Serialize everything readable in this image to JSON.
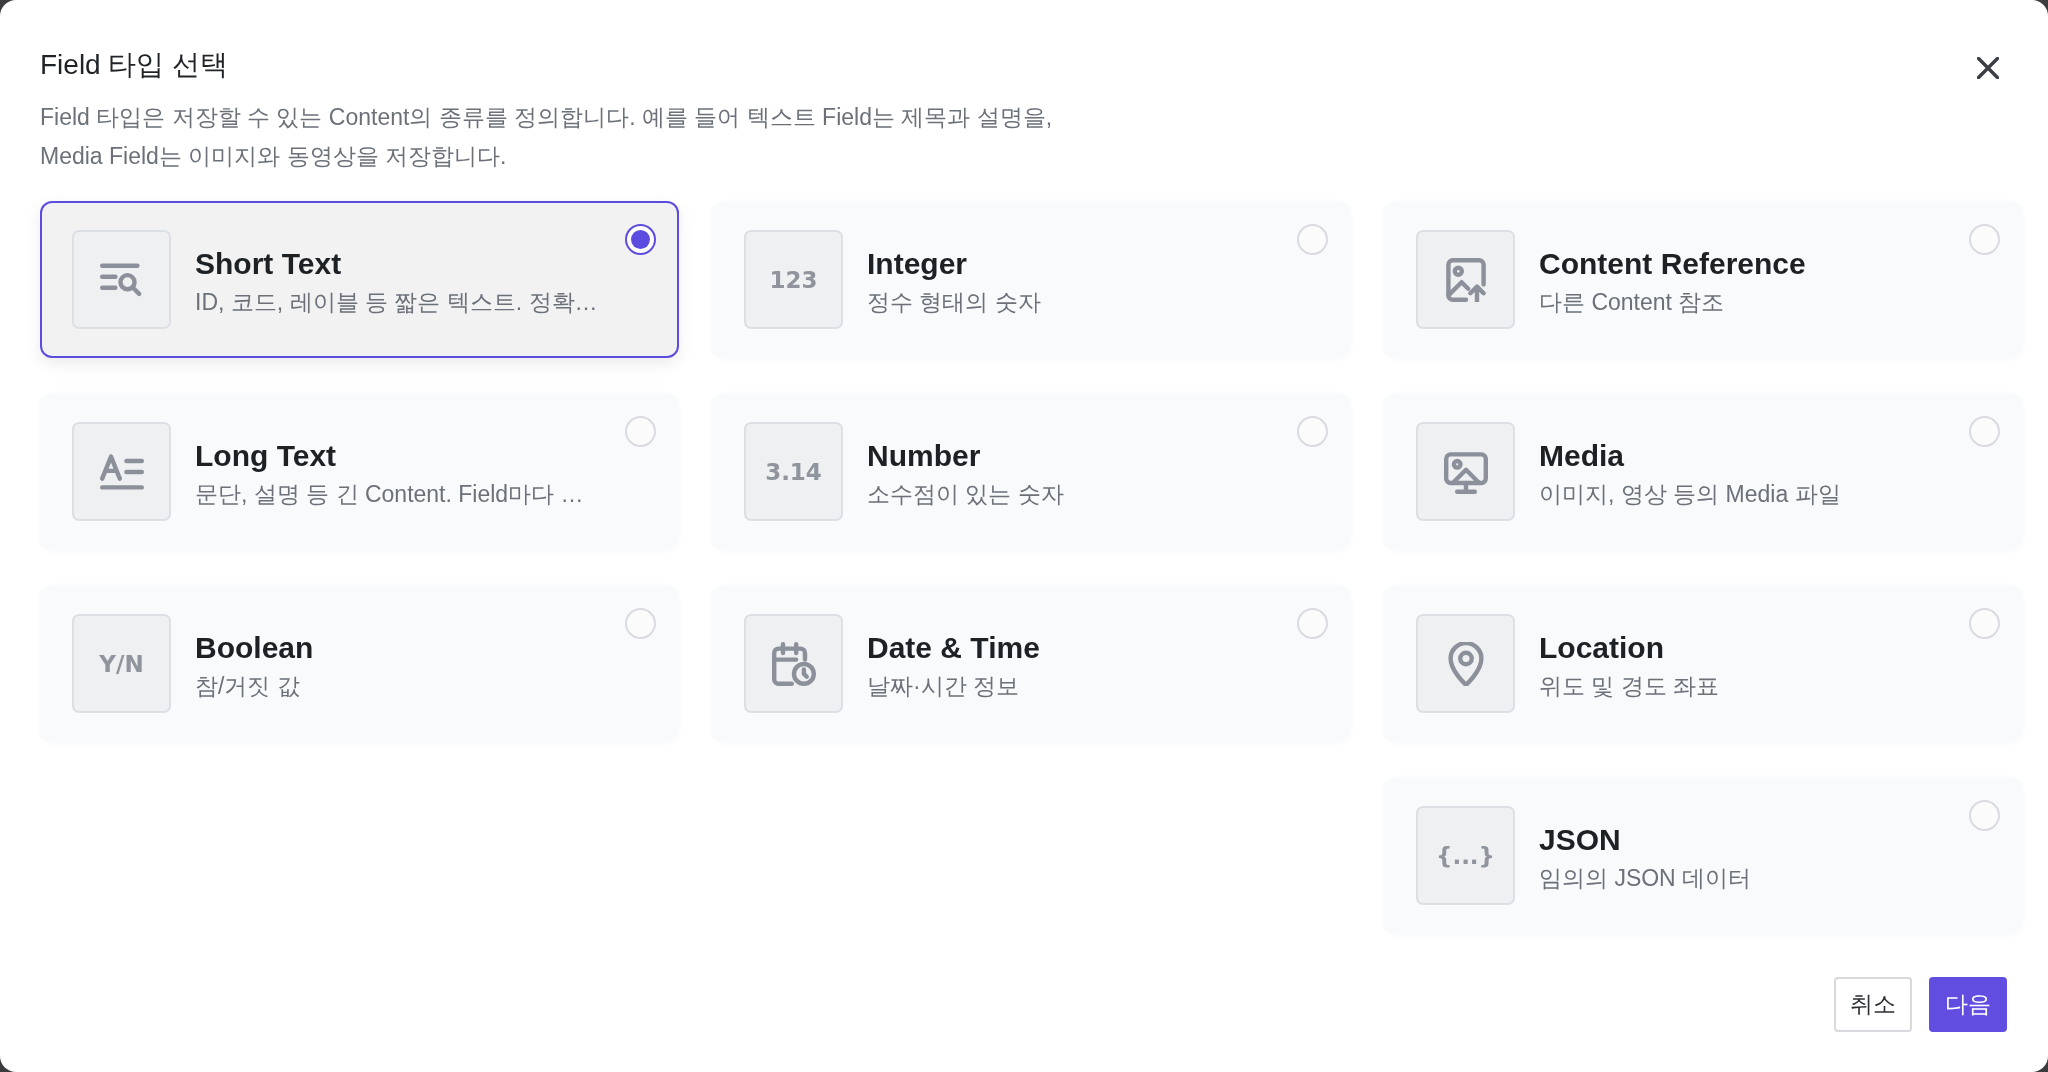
{
  "dialog": {
    "title": "Field 타입 선택",
    "description_lines": [
      "Field 타입은 저장할 수 있는 Content의 종류를 정의합니다. 예를 들어 텍스트 Field는 제목과 설명을,",
      "Media Field는 이미지와 동영상을 저장합니다."
    ],
    "columns": [
      [
        {
          "kind": "icon",
          "name": "Short Text",
          "description": "ID, 코드, 레이블 등 짧은 텍스트. 정확…",
          "selected": true
        },
        {
          "kind": "icon",
          "name": "Long Text",
          "description": "문단, 설명 등 긴 Content. Field마다 …",
          "selected": false
        },
        {
          "kind": "glyph",
          "glyph": "Y/N",
          "name": "Boolean",
          "description": "참/거짓 값",
          "selected": false
        }
      ],
      [
        {
          "kind": "glyph",
          "glyph": "123",
          "name": "Integer",
          "description": "정수 형태의 숫자",
          "selected": false
        },
        {
          "kind": "glyph",
          "glyph": "3.14",
          "name": "Number",
          "description": "소수점이 있는 숫자",
          "selected": false
        },
        {
          "kind": "icon",
          "name": "Date & Time",
          "description": "날짜·시간 정보",
          "selected": false
        }
      ],
      [
        {
          "kind": "icon",
          "name": "Content Reference",
          "description": "다른 Content 참조",
          "selected": false
        },
        {
          "kind": "icon",
          "name": "Media",
          "description": "이미지, 영상 등의 Media 파일",
          "selected": false
        },
        {
          "kind": "icon",
          "name": "Location",
          "description": "위도 및 경도 좌표",
          "selected": false
        },
        {
          "kind": "glyph",
          "glyph": "{...}",
          "name": "JSON",
          "description": "임의의 JSON 데이터",
          "selected": false
        }
      ]
    ],
    "buttons": [
      {
        "kind": "secondary",
        "label": "취소"
      },
      {
        "kind": "primary",
        "label": "다음"
      }
    ]
  }
}
